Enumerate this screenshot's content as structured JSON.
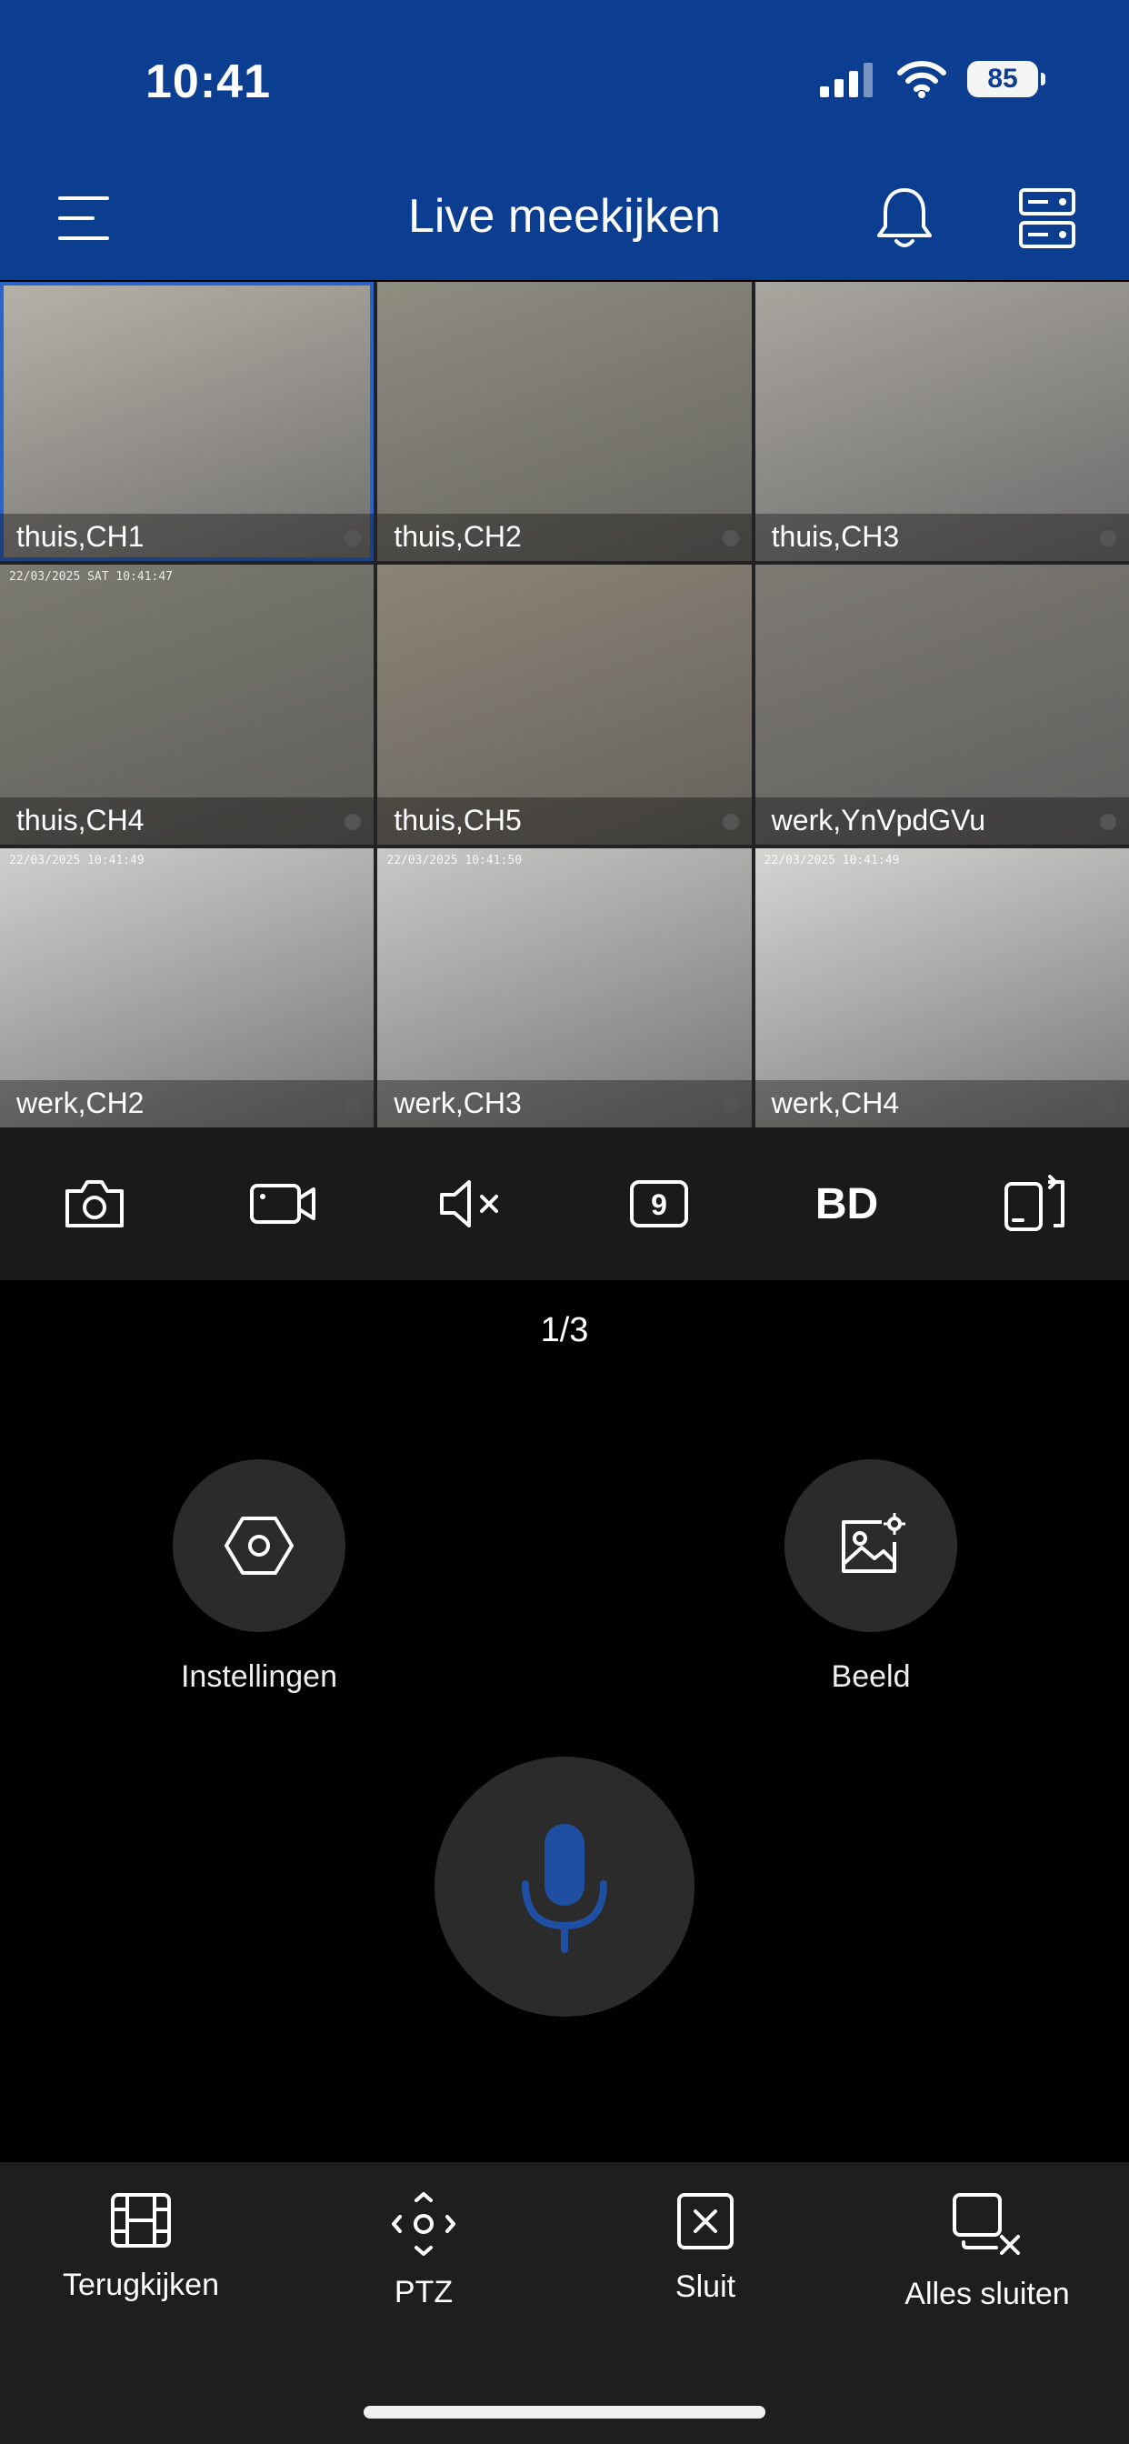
{
  "status_bar": {
    "time": "10:41",
    "battery": "85"
  },
  "header": {
    "title": "Live meekijken"
  },
  "tiles": [
    {
      "label": "thuis,CH1",
      "timestamp": "",
      "bg": "#b6b2aa",
      "selected": true
    },
    {
      "label": "thuis,CH2",
      "timestamp": "",
      "bg": "#8f8d80",
      "selected": false
    },
    {
      "label": "thuis,CH3",
      "timestamp": "",
      "bg": "#a9a6a0",
      "selected": false
    },
    {
      "label": "thuis,CH4",
      "timestamp": "22/03/2025 SAT 10:41:47",
      "bg": "#7b7a70",
      "selected": false
    },
    {
      "label": "thuis,CH5",
      "timestamp": "",
      "bg": "#8c8476",
      "selected": false
    },
    {
      "label": "werk,YnVpdGVu",
      "timestamp": "",
      "bg": "#7d7a74",
      "selected": false
    },
    {
      "label": "werk,CH2",
      "timestamp": "22/03/2025 10:41:49",
      "bg": "#cfcfcd",
      "selected": false
    },
    {
      "label": "werk,CH3",
      "timestamp": "22/03/2025 10:41:50",
      "bg": "#c9c8c5",
      "selected": false
    },
    {
      "label": "werk,CH4",
      "timestamp": "22/03/2025 10:41:49",
      "bg": "#d6d5d2",
      "selected": false
    }
  ],
  "toolbar": {
    "hd_label": "BD",
    "split_count": "9"
  },
  "page_indicator": "1/3",
  "actions": {
    "settings": "Instellingen",
    "image": "Beeld"
  },
  "bottom_bar": {
    "playback": "Terugkijken",
    "ptz": "PTZ",
    "close": "Sluit",
    "close_all": "Alles sluiten"
  },
  "colors": {
    "header": "#0b3d91",
    "mic_accent": "#1f4fa3"
  }
}
